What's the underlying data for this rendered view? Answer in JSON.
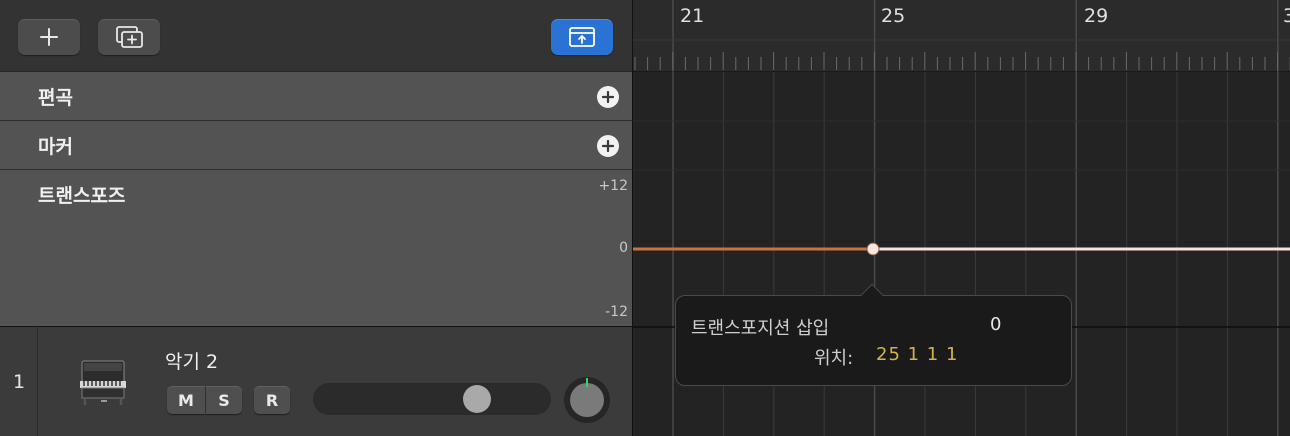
{
  "toolbar": {
    "add_track_icon": "plus-icon",
    "add_global_icon": "global-track-add-icon",
    "catch_icon": "catch-playhead-icon",
    "accent_color": "#2a72d4"
  },
  "global_tracks": [
    {
      "label": "편곡"
    },
    {
      "label": "마커"
    },
    {
      "label": "트랜스포즈"
    }
  ],
  "transpose_scale": {
    "top": "+12",
    "mid": "0",
    "bottom": "-12"
  },
  "track": {
    "number": "1",
    "name": "악기 2",
    "mute_label": "M",
    "solo_label": "S",
    "record_label": "R",
    "volume_level": 0.72,
    "instrument_icon": "piano-icon"
  },
  "ruler": {
    "bars": [
      "21",
      "25",
      "29",
      "3"
    ]
  },
  "transpose_line": {
    "color_before": "#c9743e",
    "color_after": "#f6e3d8",
    "value": 0
  },
  "tooltip": {
    "title": "트랜스포지션 삽입",
    "value": "0",
    "position_label": "위치:",
    "position_value": "25 1 1 1",
    "position_color": "#d4b24a"
  }
}
